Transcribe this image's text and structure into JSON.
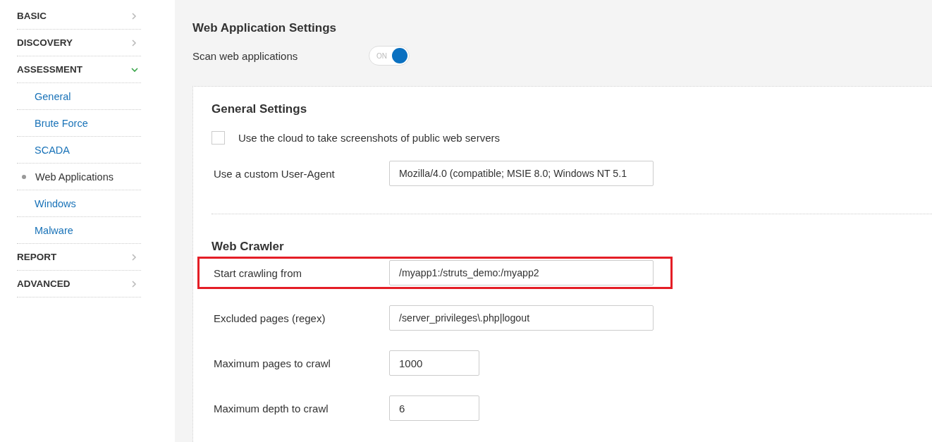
{
  "sidebar": {
    "items": [
      {
        "kind": "section",
        "label": "BASIC",
        "expanded": false
      },
      {
        "kind": "section",
        "label": "DISCOVERY",
        "expanded": false
      },
      {
        "kind": "section",
        "label": "ASSESSMENT",
        "expanded": true
      },
      {
        "kind": "sub",
        "label": "General",
        "selected": false
      },
      {
        "kind": "sub",
        "label": "Brute Force",
        "selected": false
      },
      {
        "kind": "sub",
        "label": "SCADA",
        "selected": false
      },
      {
        "kind": "sub",
        "label": "Web Applications",
        "selected": true
      },
      {
        "kind": "sub",
        "label": "Windows",
        "selected": false
      },
      {
        "kind": "sub",
        "label": "Malware",
        "selected": false
      },
      {
        "kind": "section",
        "label": "REPORT",
        "expanded": false
      },
      {
        "kind": "section",
        "label": "ADVANCED",
        "expanded": false
      }
    ]
  },
  "page": {
    "title": "Web Application Settings",
    "scan_toggle": {
      "label": "Scan web applications",
      "on": true,
      "state_text": "ON"
    }
  },
  "general_settings": {
    "title": "General Settings",
    "cloud_screenshots": {
      "label": "Use the cloud to take screenshots of public web servers",
      "checked": false
    },
    "user_agent": {
      "label": "Use a custom User-Agent",
      "value": "Mozilla/4.0 (compatible; MSIE 8.0; Windows NT 5.1"
    }
  },
  "web_crawler": {
    "title": "Web Crawler",
    "fields": [
      {
        "label": "Start crawling from",
        "value": "/myapp1:/struts_demo:/myapp2",
        "kind": "wide",
        "highlighted": true
      },
      {
        "label": "Excluded pages (regex)",
        "value": "/server_privileges\\.php|logout",
        "kind": "wide",
        "highlighted": false
      },
      {
        "label": "Maximum pages to crawl",
        "value": "1000",
        "kind": "short",
        "highlighted": false
      },
      {
        "label": "Maximum depth to crawl",
        "value": "6",
        "kind": "short",
        "highlighted": false
      }
    ]
  }
}
